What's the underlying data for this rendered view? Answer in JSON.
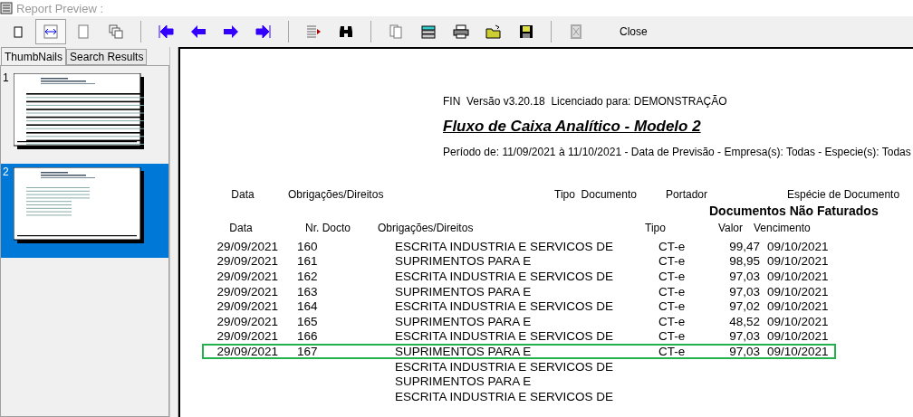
{
  "window": {
    "title": "Report Preview :"
  },
  "toolbar": [
    {
      "kind": "single-page",
      "pressed": false
    },
    {
      "kind": "page-width",
      "pressed": true
    },
    {
      "kind": "blank-page",
      "pressed": false
    },
    {
      "kind": "multi-page",
      "pressed": false
    },
    {
      "kind": "sep"
    },
    {
      "kind": "first",
      "pressed": false
    },
    {
      "kind": "prev",
      "pressed": false
    },
    {
      "kind": "next",
      "pressed": false
    },
    {
      "kind": "last",
      "pressed": false
    },
    {
      "kind": "sep"
    },
    {
      "kind": "goto",
      "pressed": false
    },
    {
      "kind": "find",
      "pressed": false
    },
    {
      "kind": "sep"
    },
    {
      "kind": "copy",
      "pressed": false
    },
    {
      "kind": "export",
      "pressed": false
    },
    {
      "kind": "print",
      "pressed": false
    },
    {
      "kind": "open",
      "pressed": false
    },
    {
      "kind": "save",
      "pressed": false
    },
    {
      "kind": "sep"
    },
    {
      "kind": "cancel",
      "pressed": false,
      "disabled": true
    },
    {
      "kind": "text",
      "label": "Close",
      "pressed": false
    }
  ],
  "tabs": [
    {
      "label": "ThumbNails",
      "selected": true
    },
    {
      "label": "Search Results",
      "selected": false
    }
  ],
  "thumbnails": [
    {
      "number": "1",
      "selected": false,
      "kind": "full"
    },
    {
      "number": "2",
      "selected": true,
      "kind": "short"
    }
  ],
  "report": {
    "header": "FIN  Versão v3.20.18  Licenciado para: DEMONSTRAÇÃO",
    "title": "Fluxo de Caixa Analítico - Modelo 2",
    "period": "Período de: 11/09/2021 à 11/10/2021 - Data de Previsão - Empresa(s): Todas - Especie(s): Todas",
    "group_headers": [
      "Data",
      "Obrigações/Direitos",
      "Tipo  Documento",
      "Portador",
      "Espécie de Documento"
    ],
    "section": "Documentos Não Faturados",
    "columns": [
      "Data",
      "Nr. Docto",
      "Obrigações/Direitos",
      "Tipo",
      "Valor",
      "Vencimento"
    ],
    "rows": [
      {
        "data": "29/09/2021",
        "nr": "160",
        "obrigacoes": "ESCRITA INDUSTRIA E SERVICOS DE",
        "tipo": "CT-e",
        "valor": "99,47",
        "vencimento": "09/10/2021",
        "selected": false
      },
      {
        "data": "29/09/2021",
        "nr": "161",
        "obrigacoes": "SUPRIMENTOS PARA E",
        "tipo": "CT-e",
        "valor": "98,95",
        "vencimento": "09/10/2021",
        "selected": false
      },
      {
        "data": "29/09/2021",
        "nr": "162",
        "obrigacoes": "ESCRITA INDUSTRIA E SERVICOS DE",
        "tipo": "CT-e",
        "valor": "97,03",
        "vencimento": "09/10/2021",
        "selected": false
      },
      {
        "data": "29/09/2021",
        "nr": "163",
        "obrigacoes": "SUPRIMENTOS PARA E",
        "tipo": "CT-e",
        "valor": "97,03",
        "vencimento": "09/10/2021",
        "selected": false
      },
      {
        "data": "29/09/2021",
        "nr": "164",
        "obrigacoes": "ESCRITA INDUSTRIA E SERVICOS DE",
        "tipo": "CT-e",
        "valor": "97,02",
        "vencimento": "09/10/2021",
        "selected": false
      },
      {
        "data": "29/09/2021",
        "nr": "165",
        "obrigacoes": "SUPRIMENTOS PARA E",
        "tipo": "CT-e",
        "valor": "48,52",
        "vencimento": "09/10/2021",
        "selected": false
      },
      {
        "data": "29/09/2021",
        "nr": "166",
        "obrigacoes": "ESCRITA INDUSTRIA E SERVICOS DE",
        "tipo": "CT-e",
        "valor": "97,03",
        "vencimento": "09/10/2021",
        "selected": false
      },
      {
        "data": "29/09/2021",
        "nr": "167",
        "obrigacoes": "SUPRIMENTOS PARA E",
        "tipo": "CT-e",
        "valor": "97,03",
        "vencimento": "09/10/2021",
        "selected": true
      },
      {
        "obrigacoes": "ESCRITA INDUSTRIA E SERVICOS DE",
        "selected": false
      },
      {
        "obrigacoes": "SUPRIMENTOS PARA E",
        "selected": false
      },
      {
        "obrigacoes": "ESCRITA INDUSTRIA E SERVICOS DE",
        "selected": false
      }
    ]
  }
}
